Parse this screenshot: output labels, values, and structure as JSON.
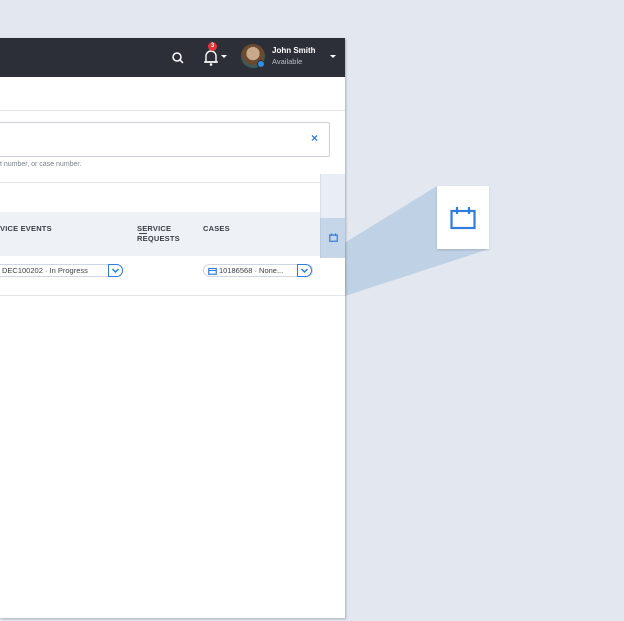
{
  "header": {
    "user_name": "John Smith",
    "user_status": "Available",
    "notification_count": "3"
  },
  "search": {
    "hint": "t number, or case number.",
    "clear_label": "×"
  },
  "table": {
    "columns": {
      "service_events": "VICE EVENTS",
      "service_requests_line1": "SERVICE",
      "service_requests_line2": "REQUESTS",
      "cases": "CASES"
    },
    "rows": [
      {
        "service_event": "DEC100202 · In Progress",
        "service_request": "—",
        "case": "10186568 · None..."
      }
    ]
  },
  "colors": {
    "accent": "#2f7de1",
    "topbar": "#2d2f38",
    "badge": "#e0353b",
    "highlight": "#c5d6e9"
  },
  "icons": {
    "search": "search-icon",
    "bell": "bell-icon",
    "calendar": "calendar-icon",
    "chevron": "chevron-down-icon",
    "close": "close-icon"
  }
}
